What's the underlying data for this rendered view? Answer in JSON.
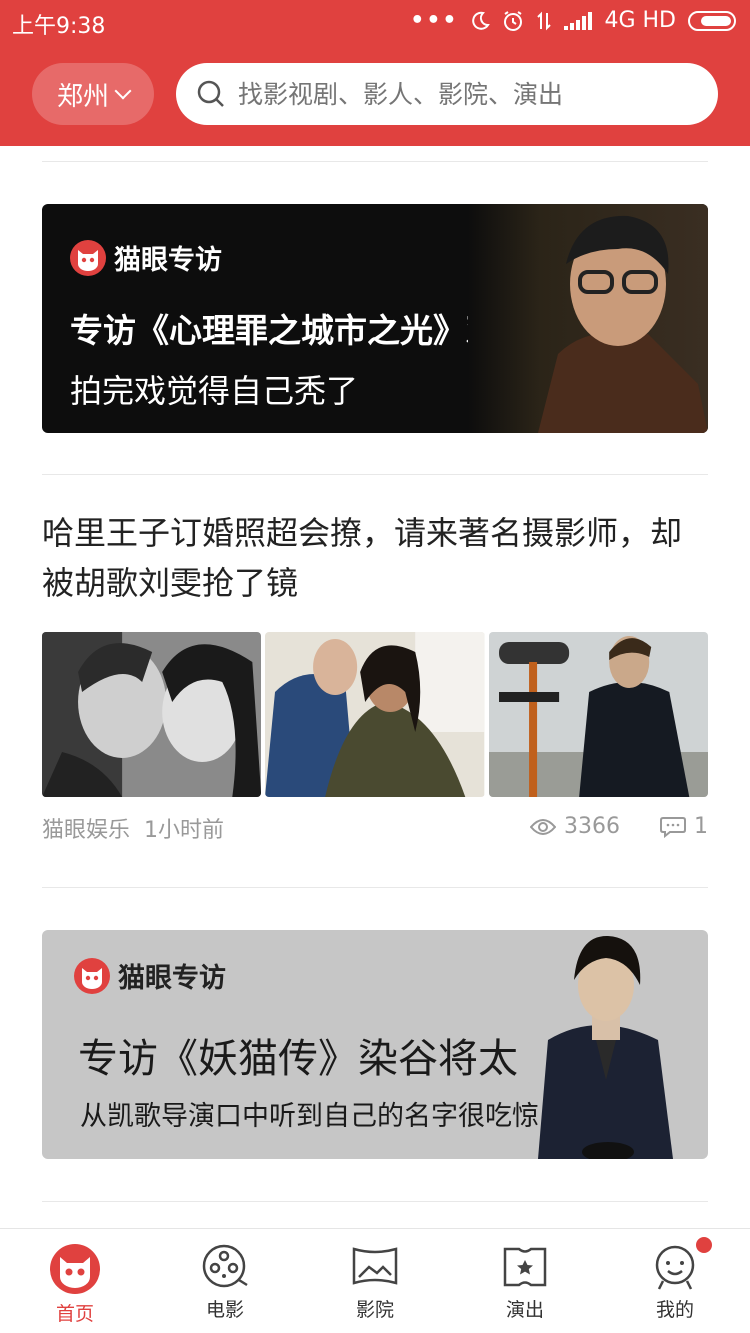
{
  "status_bar": {
    "time": "上午9:38",
    "network": "4G HD"
  },
  "header": {
    "city": "郑州",
    "search_placeholder": "找影视剧、影人、影院、演出"
  },
  "feed": {
    "banner_1": {
      "brand": "猫眼专访",
      "title": "专访《心理罪之城市之光》邓超",
      "subtitle": "拍完戏觉得自己秃了"
    },
    "article": {
      "title": "哈里王子订婚照超会撩，请来著名摄影师，却被胡歌刘雯抢了镜",
      "source": "猫眼娱乐",
      "time": "1小时前",
      "views": "3366",
      "comments": "1"
    },
    "banner_2": {
      "brand": "猫眼专访",
      "title": "专访《妖猫传》染谷将太",
      "subtitle": "从凯歌导演口中听到自己的名字很吃惊"
    }
  },
  "tabbar": {
    "items": [
      {
        "label": "首页",
        "icon": "cat-face-icon",
        "active": true
      },
      {
        "label": "电影",
        "icon": "film-reel-icon",
        "active": false
      },
      {
        "label": "影院",
        "icon": "cinema-screen-icon",
        "active": false
      },
      {
        "label": "演出",
        "icon": "ticket-star-icon",
        "active": false
      },
      {
        "label": "我的",
        "icon": "profile-face-icon",
        "active": false
      }
    ]
  },
  "colors": {
    "brand": "#e0413f",
    "text": "#222222",
    "meta": "#999999"
  }
}
